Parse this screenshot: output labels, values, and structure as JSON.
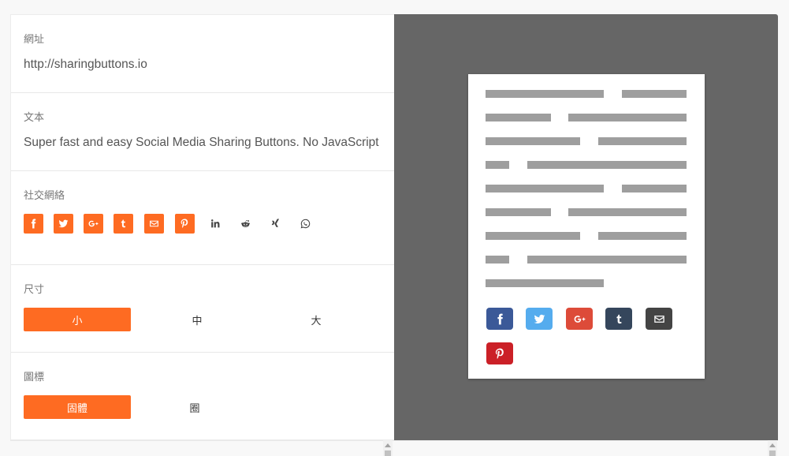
{
  "form": {
    "url": {
      "label": "網址",
      "value": "http://sharingbuttons.io"
    },
    "text": {
      "label": "文本",
      "value": "Super fast and easy Social Media Sharing Buttons. No JavaScript"
    },
    "networks": {
      "label": "社交網絡",
      "items": [
        {
          "name": "facebook",
          "icon": "facebook-icon",
          "enabled": true
        },
        {
          "name": "twitter",
          "icon": "twitter-icon",
          "enabled": true
        },
        {
          "name": "google-plus",
          "icon": "google-plus-icon",
          "enabled": true
        },
        {
          "name": "tumblr",
          "icon": "tumblr-icon",
          "enabled": true
        },
        {
          "name": "email",
          "icon": "email-icon",
          "enabled": true
        },
        {
          "name": "pinterest",
          "icon": "pinterest-icon",
          "enabled": true
        },
        {
          "name": "linkedin",
          "icon": "linkedin-icon",
          "enabled": false
        },
        {
          "name": "reddit",
          "icon": "reddit-icon",
          "enabled": false
        },
        {
          "name": "xing",
          "icon": "xing-icon",
          "enabled": false
        },
        {
          "name": "whatsapp",
          "icon": "whatsapp-icon",
          "enabled": false
        }
      ]
    },
    "size": {
      "label": "尺寸",
      "options": [
        "小",
        "中",
        "大"
      ],
      "selected": "小"
    },
    "icon": {
      "label": "圖標",
      "options": [
        "固體",
        "圈"
      ],
      "selected": "固體"
    }
  },
  "preview": {
    "buttons": [
      {
        "name": "facebook",
        "icon": "facebook-icon",
        "color": "#3b5998"
      },
      {
        "name": "twitter",
        "icon": "twitter-icon",
        "color": "#55acee"
      },
      {
        "name": "google-plus",
        "icon": "google-plus-icon",
        "color": "#dd4b39"
      },
      {
        "name": "tumblr",
        "icon": "tumblr-icon",
        "color": "#35465c"
      },
      {
        "name": "email",
        "icon": "email-icon",
        "color": "#444444"
      },
      {
        "name": "pinterest",
        "icon": "pinterest-icon",
        "color": "#cb2027"
      }
    ]
  },
  "colors": {
    "accent": "#fe6b22",
    "preview_bg": "#666666",
    "placeholder_line": "#9e9e9e"
  }
}
